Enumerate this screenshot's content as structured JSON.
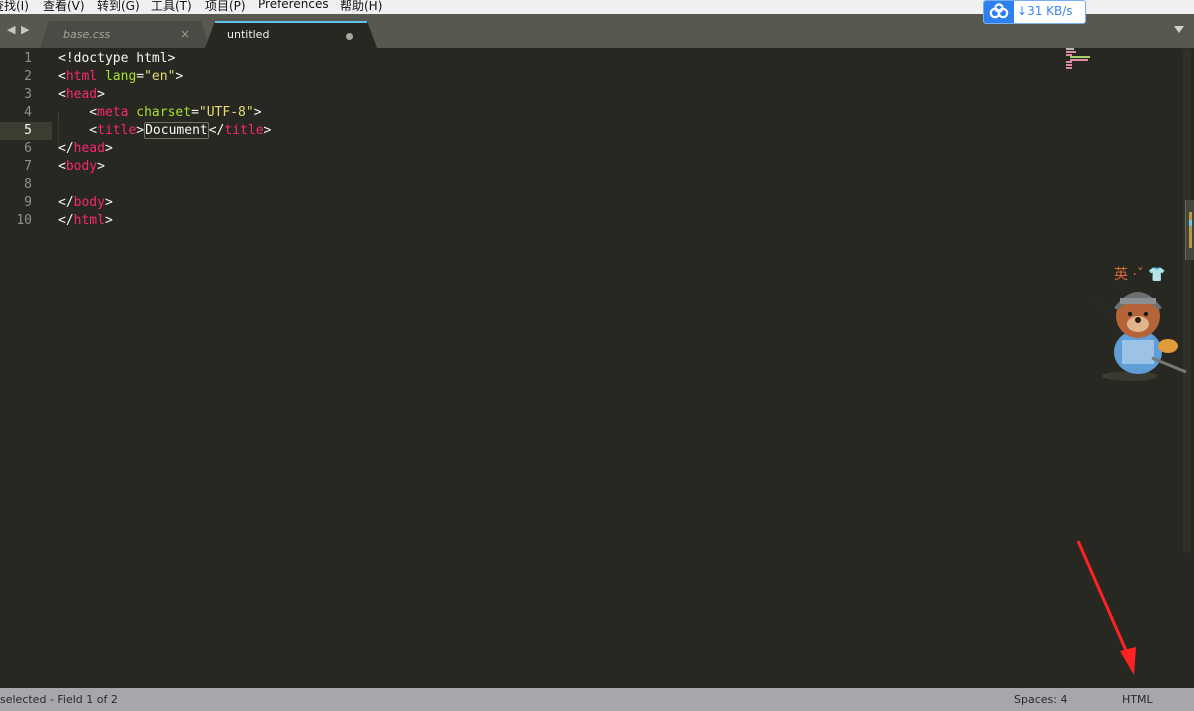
{
  "menubar": {
    "items": [
      {
        "label": "查找(I)"
      },
      {
        "label": "查看(V)"
      },
      {
        "label": "转到(G)"
      },
      {
        "label": "工具(T)"
      },
      {
        "label": "项目(P)"
      },
      {
        "label": "Preferences"
      },
      {
        "label": "帮助(H)"
      }
    ]
  },
  "tabs": [
    {
      "label": "base.css",
      "state": "inactive",
      "close_icon": "×"
    },
    {
      "label": "untitled",
      "state": "active-unsaved"
    }
  ],
  "download_widget": {
    "icon": "baidu-netdisk-icon",
    "speed": "31 KB/s",
    "arrow": "↓"
  },
  "editor": {
    "current_line": 5,
    "lines": [
      {
        "num": "1",
        "text": "<!doctype html>"
      },
      {
        "num": "2",
        "text": "<html lang=\"en\">"
      },
      {
        "num": "3",
        "text": "<head>"
      },
      {
        "num": "4",
        "text": "    <meta charset=\"UTF-8\">"
      },
      {
        "num": "5",
        "text": "    <title>Document</title>"
      },
      {
        "num": "6",
        "text": "</head>"
      },
      {
        "num": "7",
        "text": "<body>"
      },
      {
        "num": "8",
        "text": ""
      },
      {
        "num": "9",
        "text": "</body>"
      },
      {
        "num": "10",
        "text": "</html>"
      }
    ],
    "selected_text": "Document"
  },
  "statusbar": {
    "left": "selected - Field 1 of 2",
    "spaces": "Spaces: 4",
    "syntax": "HTML"
  },
  "mascot": {
    "text": "英 ·ˇ 👕"
  },
  "colors": {
    "background": "#272822",
    "tag": "#f92672",
    "attribute": "#a6e22e",
    "string": "#e6db74",
    "text": "#f8f8f2",
    "line_number": "#8f908a",
    "tabbar": "#57584f",
    "statusbar": "#a5a7ac",
    "annotation_arrow": "#ff2222"
  }
}
